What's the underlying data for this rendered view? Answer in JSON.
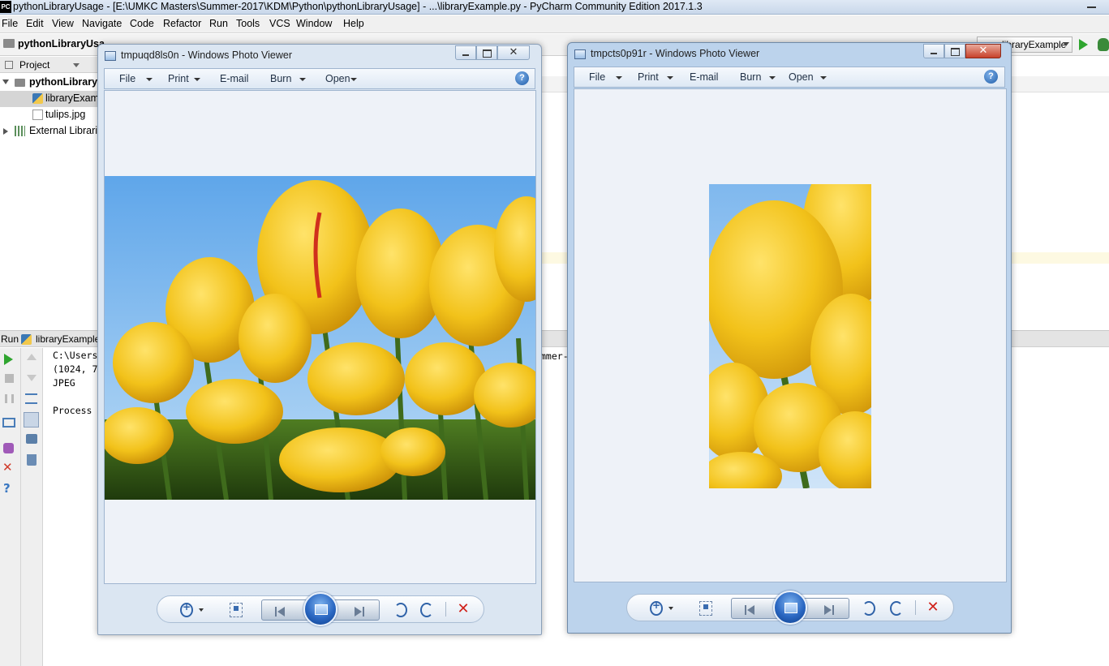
{
  "ide": {
    "title": "pythonLibraryUsage - [E:\\UMKC Masters\\Summer-2017\\KDM\\Python\\pythonLibraryUsage] - ...\\libraryExample.py - PyCharm Community Edition 2017.1.3",
    "logo": "PC",
    "menu": [
      "File",
      "Edit",
      "View",
      "Navigate",
      "Code",
      "Refactor",
      "Run",
      "Tools",
      "VCS",
      "Window",
      "Help"
    ],
    "navbar": {
      "project": "pythonLibraryUsa",
      "run_config": "libraryExample"
    },
    "project_pane": {
      "header": "Project",
      "tree": [
        {
          "label": "pythonLibraryU",
          "icon": "folder-icon",
          "expanded": true
        },
        {
          "label": "libraryExamp",
          "icon": "python-file-icon",
          "selected": true
        },
        {
          "label": "tulips.jpg",
          "icon": "image-file-icon"
        },
        {
          "label": "External Librarie",
          "icon": "libraries-icon",
          "expanded": false
        }
      ]
    },
    "run_pane": {
      "label": "Run",
      "config": "libraryExample",
      "console": [
        "C:\\Users",
        "(1024, 7",
        "JPEG",
        "",
        "Process "
      ],
      "console_tail": "mmer-"
    }
  },
  "viewer_left": {
    "title": "tmpuqd8ls0n - Windows Photo Viewer",
    "active": false,
    "menu": [
      {
        "label": "File",
        "dropdown": true
      },
      {
        "label": "Print",
        "dropdown": true
      },
      {
        "label": "E-mail",
        "dropdown": false
      },
      {
        "label": "Burn",
        "dropdown": true
      },
      {
        "label": "Open",
        "dropdown": true
      }
    ],
    "help_glyph": "?",
    "delete_glyph": "✕",
    "close_glyph": "✕",
    "image_icon": "tulips-photo"
  },
  "viewer_right": {
    "title": "tmpcts0p91r - Windows Photo Viewer",
    "active": true,
    "menu": [
      {
        "label": "File",
        "dropdown": true
      },
      {
        "label": "Print",
        "dropdown": true
      },
      {
        "label": "E-mail",
        "dropdown": false
      },
      {
        "label": "Burn",
        "dropdown": true
      },
      {
        "label": "Open",
        "dropdown": true
      }
    ],
    "help_glyph": "?",
    "delete_glyph": "✕",
    "close_glyph": "✕",
    "image_icon": "tulips-cropped-photo"
  },
  "colors": {
    "tulip_yellow": "#f2c21a",
    "sky_blue": "#7fb8ee",
    "stem_green": "#3f6b1c",
    "viewer_frame_active": "#bcd3ec",
    "close_red": "#c7412a"
  }
}
